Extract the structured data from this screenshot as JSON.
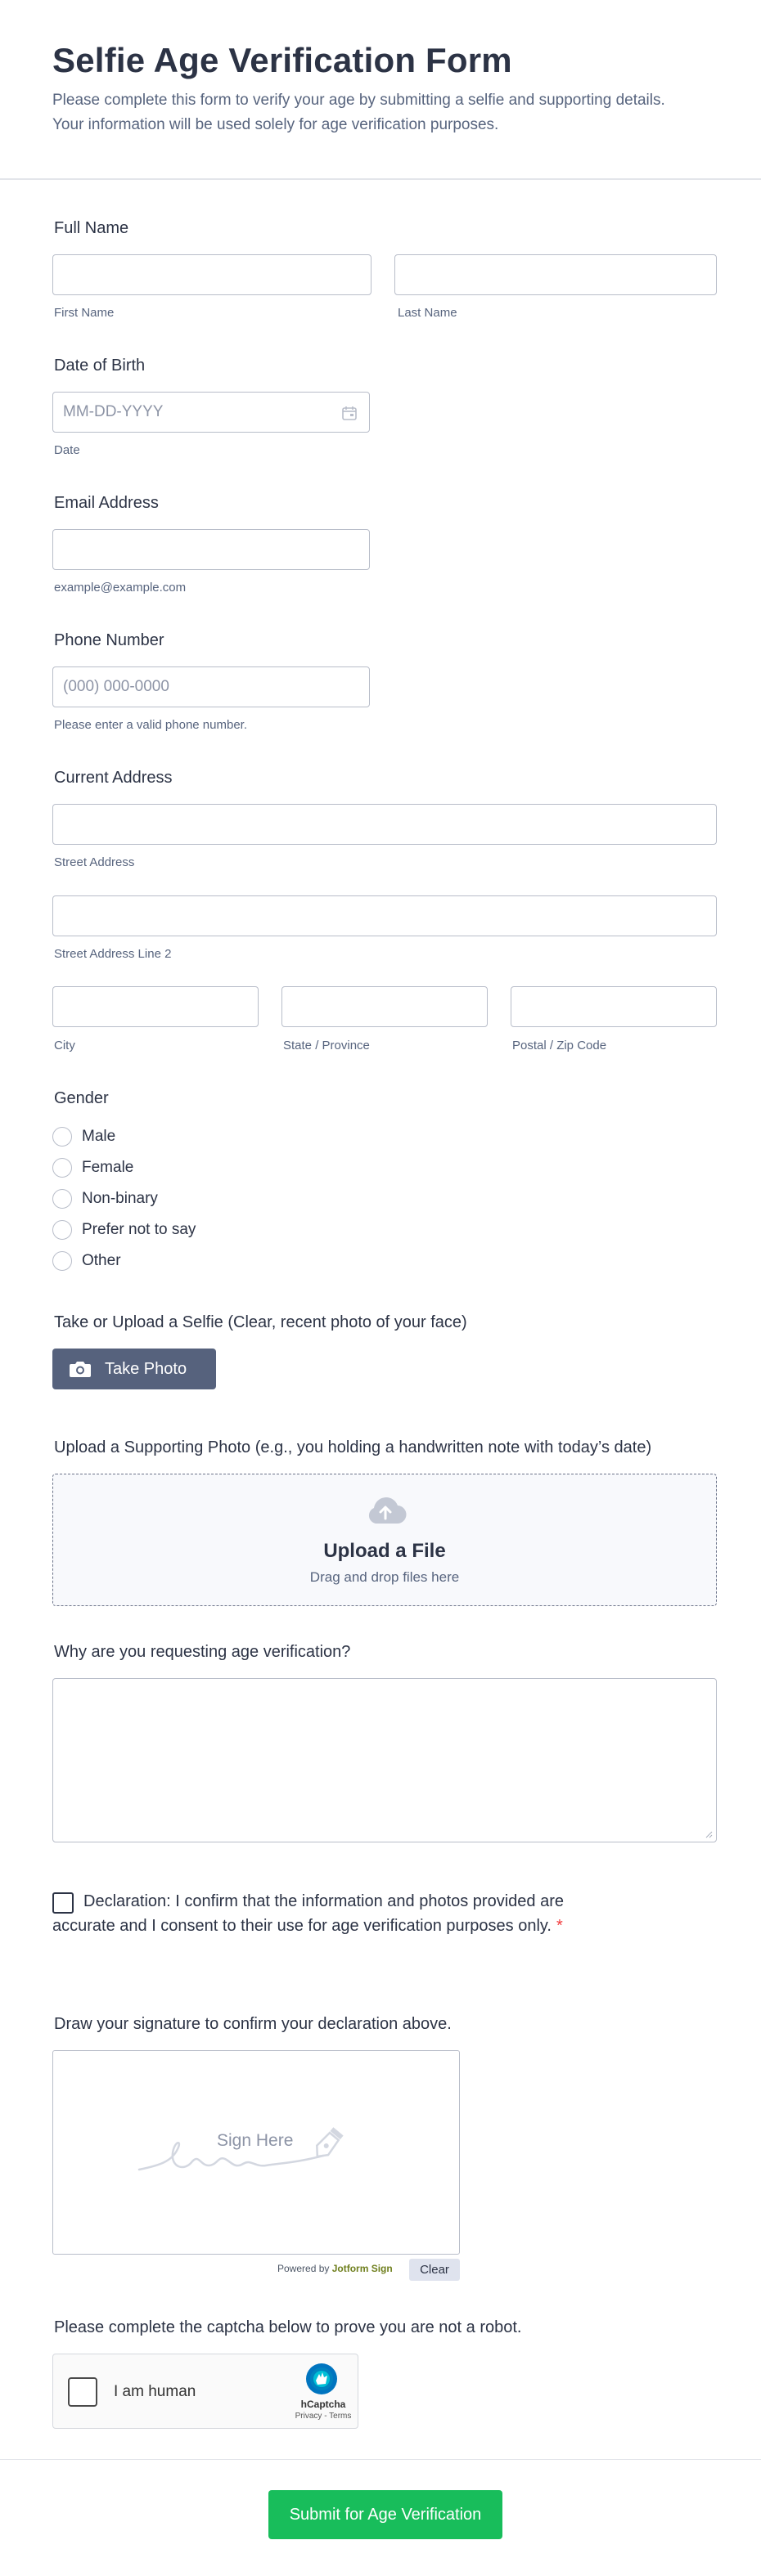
{
  "header": {
    "title": "Selfie Age Verification Form",
    "description": "Please complete this form to verify your age by submitting a selfie and supporting details. Your information will be used solely for age verification purposes."
  },
  "full_name": {
    "label": "Full Name",
    "first_sub": "First Name",
    "last_sub": "Last Name",
    "first_value": "",
    "last_value": ""
  },
  "dob": {
    "label": "Date of Birth",
    "placeholder": "MM-DD-YYYY",
    "sub": "Date",
    "icon": "calendar-icon"
  },
  "email": {
    "label": "Email Address",
    "sub": "example@example.com",
    "value": ""
  },
  "phone": {
    "label": "Phone Number",
    "placeholder": "(000) 000-0000",
    "sub": "Please enter a valid phone number."
  },
  "address": {
    "label": "Current Address",
    "street_sub": "Street Address",
    "street2_sub": "Street Address Line 2",
    "city_sub": "City",
    "state_sub": "State / Province",
    "zip_sub": "Postal / Zip Code"
  },
  "gender": {
    "label": "Gender",
    "options": [
      "Male",
      "Female",
      "Non-binary",
      "Prefer not to say",
      "Other"
    ]
  },
  "selfie": {
    "label": "Take or Upload a Selfie (Clear, recent photo of your face)",
    "button": "Take Photo",
    "icon": "camera-icon"
  },
  "supporting": {
    "label": "Upload a Supporting Photo (e.g., you holding a handwritten note with today’s date)",
    "title": "Upload a File",
    "sub": "Drag and drop files here",
    "icon": "cloud-upload-icon"
  },
  "reason": {
    "label": "Why are you requesting age verification?",
    "value": ""
  },
  "declaration": {
    "text": "Declaration: I confirm that the information and photos provided are accurate and I consent to their use for age verification purposes only.",
    "required_mark": "*",
    "checked": false
  },
  "signature": {
    "label": "Draw your signature to confirm your declaration above.",
    "placeholder": "Sign Here",
    "powered_prefix": "Powered by",
    "powered_brand": "Jotform Sign",
    "clear": "Clear"
  },
  "captcha": {
    "label": "Please complete the captcha below to prove you are not a robot.",
    "checkbox_text": "I am human",
    "brand": "hCaptcha",
    "links": "Privacy - Terms"
  },
  "submit": {
    "label": "Submit for Age Verification"
  },
  "colors": {
    "accent_button": "#56627d",
    "submit": "#18bd5b",
    "required": "#f23a3c",
    "text": "#2c3345"
  }
}
